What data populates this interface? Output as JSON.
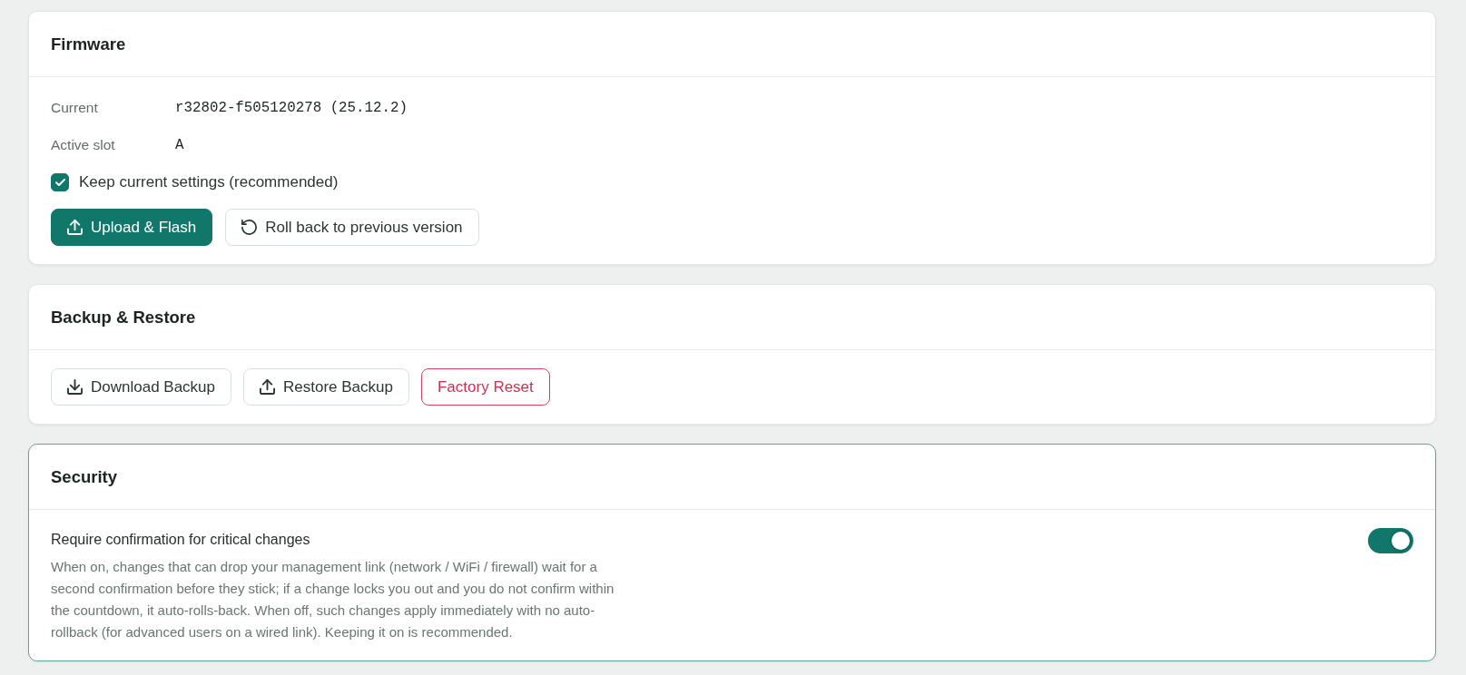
{
  "firmware": {
    "title": "Firmware",
    "highlighted": false,
    "fields": [
      {
        "label": "Current",
        "value": "r32802-f505120278 (25.12.2)"
      },
      {
        "label": "Active slot",
        "value": "A"
      }
    ],
    "keep_settings": {
      "label": "Keep current settings (recommended)",
      "checked": true
    },
    "buttons": [
      {
        "label": "Upload & Flash",
        "kind": "flash"
      },
      {
        "label": "Roll back to previous version",
        "kind": "rollback"
      }
    ]
  },
  "backup_restore": {
    "title": "Backup & Restore",
    "highlighted": false,
    "buttons": [
      {
        "label": "Download Backup",
        "kind": "download"
      },
      {
        "label": "Restore Backup",
        "kind": "restore"
      },
      {
        "label": "Factory Reset",
        "kind": "reset"
      }
    ]
  },
  "security": {
    "title": "Security",
    "highlighted": true,
    "settings": [
      {
        "label": "Require confirmation for critical changes",
        "description": "When on, changes that can drop your management link (network / WiFi / firewall) wait for a second confirmation before they stick; if a change locks you out and you do not confirm within the countdown, it auto-rolls-back. When off, such changes apply immediately with no auto-rollback (for advanced users on a wired link). Keeping it on is recommended.",
        "on": true
      }
    ]
  }
}
